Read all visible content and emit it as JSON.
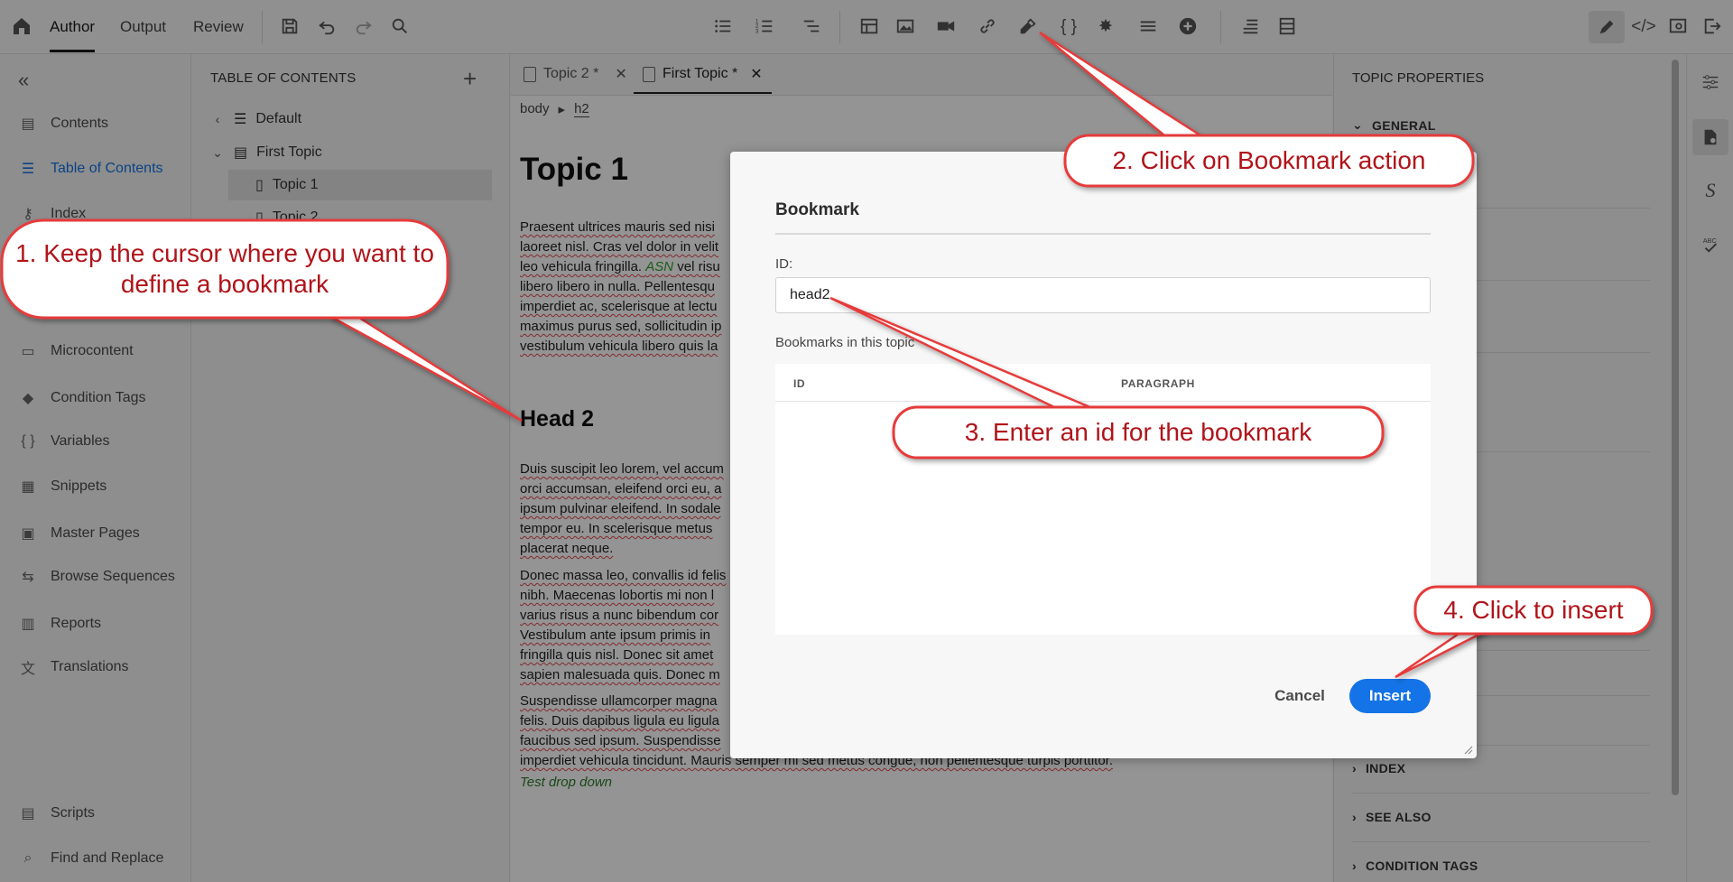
{
  "toolbar": {
    "modes": [
      "Author",
      "Output",
      "Review"
    ],
    "active_mode": "Author"
  },
  "leftnav": {
    "items": [
      {
        "label": "Contents",
        "icon": "contents-icon"
      },
      {
        "label": "Table of Contents",
        "icon": "toc-icon",
        "active": true
      },
      {
        "label": "Index",
        "icon": "index-icon"
      },
      {
        "label": "Microcontent",
        "icon": "microcontent-icon"
      },
      {
        "label": "Condition Tags",
        "icon": "tag-icon"
      },
      {
        "label": "Variables",
        "icon": "braces-icon"
      },
      {
        "label": "Snippets",
        "icon": "snippets-icon"
      },
      {
        "label": "Master Pages",
        "icon": "master-pages-icon"
      },
      {
        "label": "Browse Sequences",
        "icon": "browse-sequences-icon"
      },
      {
        "label": "Reports",
        "icon": "reports-icon"
      },
      {
        "label": "Translations",
        "icon": "translations-icon"
      },
      {
        "label": "Scripts",
        "icon": "scripts-icon"
      },
      {
        "label": "Find and Replace",
        "icon": "find-replace-icon"
      }
    ]
  },
  "toc": {
    "title": "TABLE OF CONTENTS",
    "items": [
      "Default",
      "First Topic",
      "Topic 1",
      "Topic 2"
    ]
  },
  "editor": {
    "tabs": [
      {
        "label": "Topic 2 *"
      },
      {
        "label": "First Topic *",
        "active": true
      }
    ],
    "breadcrumb": [
      "body",
      "h2"
    ],
    "heading1": "Topic 1",
    "heading2": "Head 2",
    "paragraphs": {
      "p1": "Praesent ultrices mauris sed nisi\nlaoreet nisl. Cras vel dolor in velit\nleo vehicula fringilla.",
      "p1_green": "ASN",
      "p1_rest": " vel risu\nlibero libero in nulla. Pellentesqu\nimperdiet ac, scelerisque at lectu\nmaximus purus sed, sollicitudin ip\nvestibulum vehicula libero quis la",
      "p2": "Duis suscipit leo lorem, vel accum\norci accumsan, eleifend orci eu, a\nipsum pulvinar eleifend. In sodale\ntempor eu. In scelerisque metus\nplacerat neque.",
      "p3": "Donec massa leo, convallis id felis\nnibh. Maecenas lobortis mi non l\nvarius risus a nunc bibendum cor\nVestibulum ante ipsum primis in\nfringilla quis nisl. Donec sit amet\nsapien malesuada quis. Donec m",
      "p4": "Suspendisse ullamcorper magna\nfelis. Duis dapibus ligula eu ligula\nfaucibus sed ipsum. Suspendisse\nimperdiet vehicula tincidunt. Mauris semper mi sed metus congue, non pellentesque turpis porttitor."
    },
    "green_line": "Test drop down"
  },
  "properties": {
    "title": "TOPIC PROPERTIES",
    "sections": [
      "GENERAL",
      "INDEX",
      "SEE ALSO",
      "CONDITION TAGS"
    ]
  },
  "modal": {
    "title": "Bookmark",
    "id_label": "ID:",
    "id_value": "head2",
    "bookmarks_label": "Bookmarks in this topic",
    "columns": [
      "ID",
      "PARAGRAPH"
    ],
    "cancel_label": "Cancel",
    "insert_label": "Insert"
  },
  "annotations": {
    "step1": "1. Keep the cursor where you want to define a bookmark",
    "step2": "2. Click on Bookmark action",
    "step3": "3. Enter an id for the bookmark",
    "step4": "4. Click to insert",
    "fill_color": "#ffffff",
    "text_color": "#b0141a",
    "border_color": "#e63b3b"
  },
  "colors": {
    "accent": "#1473e6",
    "callout_red": "#e63b3b"
  }
}
